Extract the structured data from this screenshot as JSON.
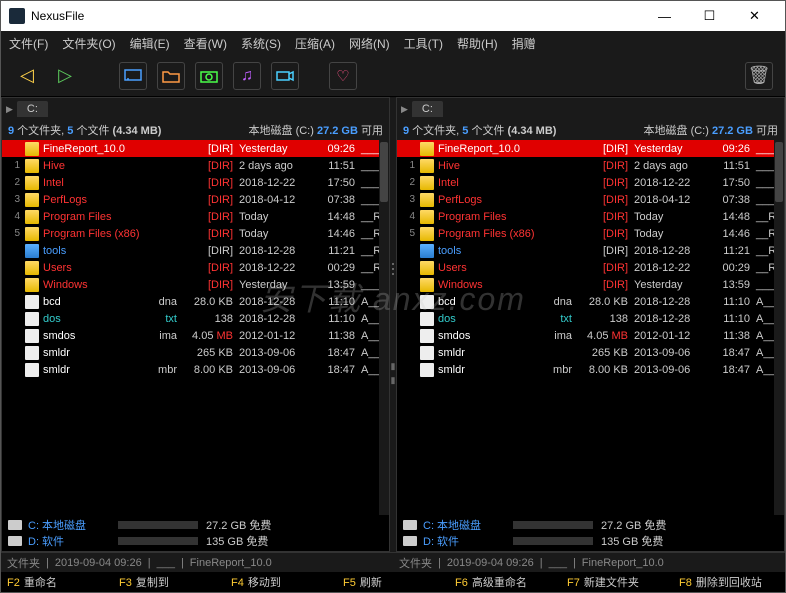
{
  "app": {
    "title": "NexusFile"
  },
  "winbtns": {
    "min": "—",
    "max": "☐",
    "close": "✕"
  },
  "menu": [
    "文件(F)",
    "文件夹(O)",
    "编辑(E)",
    "查看(W)",
    "系统(S)",
    "压缩(A)",
    "网络(N)",
    "工具(T)",
    "帮助(H)",
    "捐赠"
  ],
  "toolbar": {
    "back": "◁",
    "fwd": "▷",
    "trash": "🗑"
  },
  "pane": {
    "path_label": "C:",
    "summary_prefix": "9",
    "summary_mid": " 个文件夹, ",
    "summary_files": "5",
    "summary_suffix": " 个文件 ",
    "summary_size": "(4.34 MB)",
    "disk_label": "本地磁盘 (C:) ",
    "disk_free": "27.2 GB",
    "disk_avail": " 可用"
  },
  "rows": [
    {
      "n": "",
      "name": "FineReport_10.0",
      "ext": "",
      "size": "[DIR]",
      "date": "Yesterday",
      "time": "09:26",
      "attr": "___",
      "cls": "selected",
      "itype": "folder-icon"
    },
    {
      "n": "1",
      "name": "Hive",
      "ext": "",
      "size": "[DIR]",
      "date": "2 days ago",
      "time": "11:51",
      "attr": "___",
      "cls": "dir-red",
      "itype": "folder-icon"
    },
    {
      "n": "2",
      "name": "Intel",
      "ext": "",
      "size": "[DIR]",
      "date": "2018-12-22",
      "time": "17:50",
      "attr": "___",
      "cls": "dir-red",
      "itype": "folder-icon"
    },
    {
      "n": "3",
      "name": "PerfLogs",
      "ext": "",
      "size": "[DIR]",
      "date": "2018-04-12",
      "time": "07:38",
      "attr": "___",
      "cls": "dir-red",
      "itype": "folder-icon"
    },
    {
      "n": "4",
      "name": "Program Files",
      "ext": "",
      "size": "[DIR]",
      "date": "Today",
      "time": "14:48",
      "attr": "__R_",
      "cls": "dir-red",
      "itype": "folder-icon"
    },
    {
      "n": "5",
      "name": "Program Files (x86)",
      "ext": "",
      "size": "[DIR]",
      "date": "Today",
      "time": "14:46",
      "attr": "__R_",
      "cls": "dir-red",
      "itype": "folder-icon"
    },
    {
      "n": "",
      "name": "tools",
      "ext": "",
      "size": "[DIR]",
      "date": "2018-12-28",
      "time": "11:21",
      "attr": "__R_",
      "cls": "dir-blue",
      "itype": "folder-icon blue"
    },
    {
      "n": "",
      "name": "Users",
      "ext": "",
      "size": "[DIR]",
      "date": "2018-12-22",
      "time": "00:29",
      "attr": "__R_",
      "cls": "dir-red",
      "itype": "folder-icon"
    },
    {
      "n": "",
      "name": "Windows",
      "ext": "",
      "size": "[DIR]",
      "date": "Yesterday",
      "time": "13:59",
      "attr": "___",
      "cls": "dir-red",
      "itype": "folder-icon"
    },
    {
      "n": "",
      "name": "bcd",
      "ext": "dna",
      "size": "28.0 KB",
      "date": "2018-12-28",
      "time": "11:10",
      "attr": "A___",
      "cls": "file-white",
      "itype": "file-icon"
    },
    {
      "n": "",
      "name": "dos",
      "ext": "txt",
      "size": "138",
      "date": "2018-12-28",
      "time": "11:10",
      "attr": "A___",
      "cls": "file-cyan",
      "itype": "file-icon"
    },
    {
      "n": "",
      "name": "smdos",
      "ext": "ima",
      "size": "4.05 MB",
      "date": "2012-01-12",
      "time": "11:38",
      "attr": "A___",
      "cls": "file-white",
      "itype": "file-icon",
      "mb": true
    },
    {
      "n": "",
      "name": "smldr",
      "ext": "",
      "size": "265 KB",
      "date": "2013-09-06",
      "time": "18:47",
      "attr": "A___",
      "cls": "file-white",
      "itype": "file-icon"
    },
    {
      "n": "",
      "name": "smldr",
      "ext": "mbr",
      "size": "8.00 KB",
      "date": "2013-09-06",
      "time": "18:47",
      "attr": "A___",
      "cls": "file-white",
      "itype": "file-icon"
    }
  ],
  "drives": [
    {
      "name": "C: 本地磁盘",
      "fill": 60,
      "free": "27.2 GB 免费"
    },
    {
      "name": "D: 软件",
      "fill": 5,
      "free": "135 GB 免费"
    }
  ],
  "bottom": {
    "type": "文件夹",
    "date": "2019-09-04 09:26",
    "attr": "___",
    "sel": "FineReport_10.0"
  },
  "fkeys": [
    {
      "k": "F2",
      "l": "重命名"
    },
    {
      "k": "F3",
      "l": "复制到"
    },
    {
      "k": "F4",
      "l": "移动到"
    },
    {
      "k": "F5",
      "l": "刷新"
    },
    {
      "k": "F6",
      "l": "高级重命名"
    },
    {
      "k": "F7",
      "l": "新建文件夹"
    },
    {
      "k": "F8",
      "l": "删除到回收站"
    }
  ],
  "watermark": "安下载\nanxz.com"
}
